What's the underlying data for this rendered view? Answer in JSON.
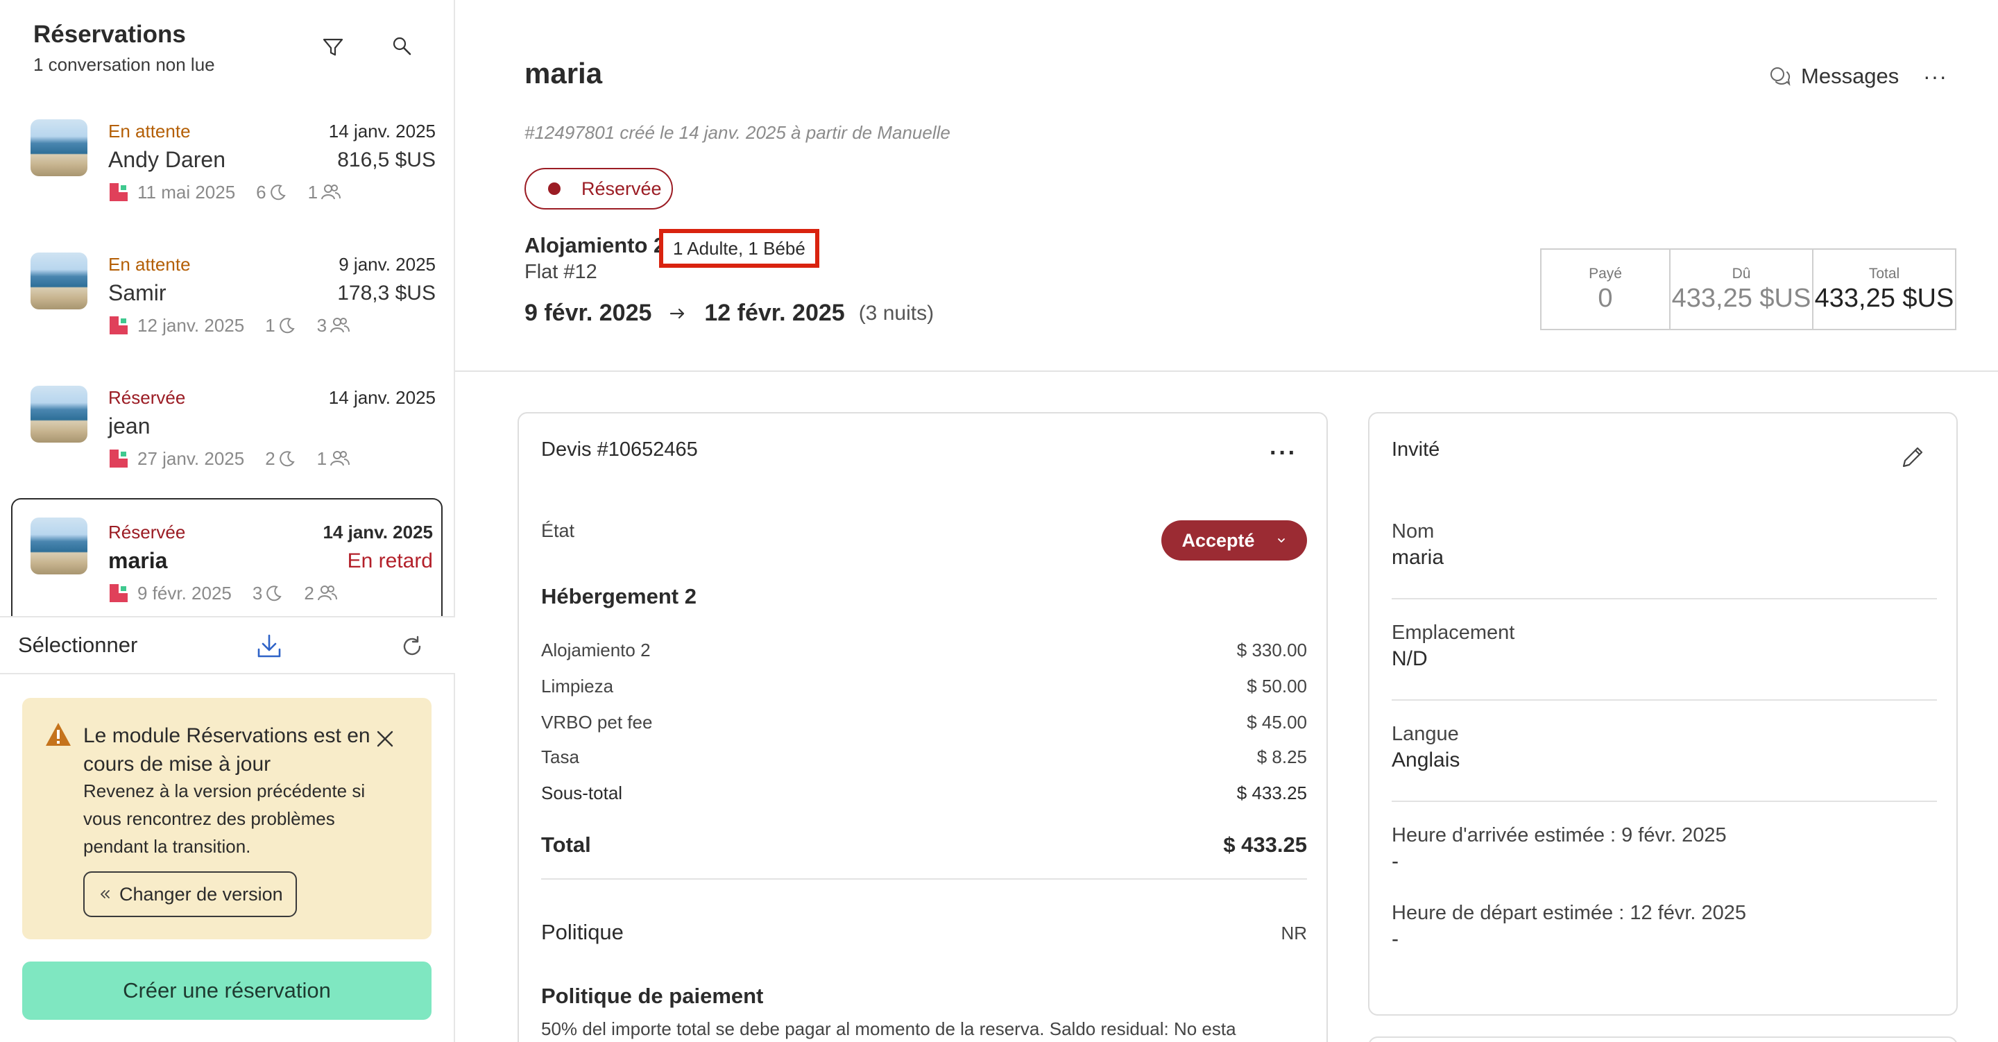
{
  "sidebar": {
    "title": "Réservations",
    "subtitle": "1 conversation non lue",
    "reservations": [
      {
        "status": "En attente",
        "date": "14 janv. 2025",
        "name": "Andy Daren",
        "amount": "816,5 $US",
        "checkin": "11 mai 2025",
        "nights": "6",
        "guests": "1"
      },
      {
        "status": "En attente",
        "date": "9 janv. 2025",
        "name": "Samir",
        "amount": "178,3 $US",
        "checkin": "12 janv. 2025",
        "nights": "1",
        "guests": "3"
      },
      {
        "status": "Réservée",
        "date": "14 janv. 2025",
        "name": "jean",
        "amount": "",
        "checkin": "27 janv. 2025",
        "nights": "2",
        "guests": "1"
      },
      {
        "status": "Réservée",
        "date": "14 janv. 2025",
        "name": "maria",
        "amount": "En retard",
        "checkin": "9 févr. 2025",
        "nights": "3",
        "guests": "2"
      }
    ],
    "actions": {
      "select_label": "Sélectionner"
    },
    "notice": {
      "title": "Le module Réservations est en cours de mise à jour",
      "body": "Revenez à la version précédente si vous rencontrez des problèmes pendant la transition.",
      "button": "Changer de version"
    },
    "create_button": "Créer une réservation"
  },
  "header": {
    "guest_name": "maria",
    "meta": "#12497801 créé le 14 janv. 2025 à partir de Manuelle",
    "messages_label": "Messages",
    "more": "···",
    "status": "Réservée",
    "property": "Alojamiento 2",
    "guests_summary": "1 Adulte, 1 Bébé",
    "unit": "Flat #12",
    "checkin": "9 févr. 2025",
    "checkout": "12 févr. 2025",
    "nights": "(3 nuits)"
  },
  "payment": {
    "paid_label": "Payé",
    "paid_value": "0",
    "due_label": "Dû",
    "due_value": "433,25 $US",
    "total_label": "Total",
    "total_value": "433,25 $US"
  },
  "quote": {
    "title": "Devis #10652465",
    "state_label": "État",
    "state_value": "Accepté",
    "section": "Hébergement 2",
    "lines": [
      {
        "label": "Alojamiento 2",
        "amount": "$ 330.00"
      },
      {
        "label": "Limpieza",
        "amount": "$ 50.00"
      },
      {
        "label": "VRBO pet fee",
        "amount": "$ 45.00"
      },
      {
        "label": "Tasa",
        "amount": "$ 8.25"
      },
      {
        "label": "Sous-total",
        "amount": "$ 433.25"
      }
    ],
    "total_label": "Total",
    "total_value": "$ 433.25",
    "policy_label": "Politique",
    "policy_value": "NR",
    "payment_policy_title": "Politique de paiement",
    "payment_policy_text": "50% del importe total se debe pagar al momento de la reserva. Saldo residual: No esta"
  },
  "guest": {
    "title": "Invité",
    "fields": [
      {
        "label": "Nom",
        "value": "maria"
      },
      {
        "label": "Emplacement",
        "value": "N/D"
      },
      {
        "label": "Langue",
        "value": "Anglais"
      },
      {
        "label": "Heure d'arrivée estimée : 9 févr. 2025",
        "value": "-"
      },
      {
        "label": "Heure de départ estimée : 12 févr. 2025",
        "value": "-"
      }
    ]
  },
  "colors": {
    "reserved": "#9b1c24",
    "waiting": "#b45f06",
    "accept_button": "#9b2b33",
    "create_button": "#7fe7c1",
    "notice_bg": "#f8ecc9",
    "highlight_box": "#d9230f"
  },
  "icons": [
    "filter-icon",
    "search-icon",
    "download-icon",
    "refresh-icon",
    "warning-icon",
    "close-icon",
    "chevrons-left-icon",
    "chat-icon",
    "more-icon",
    "arrow-right-icon",
    "chevron-down-icon",
    "pencil-icon",
    "moon-icon",
    "people-icon",
    "airbnb-source-icon"
  ]
}
